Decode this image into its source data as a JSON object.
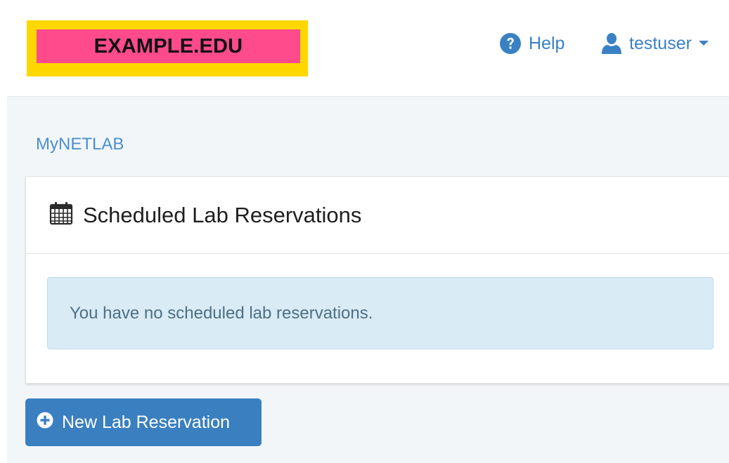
{
  "header": {
    "logo_text": "EXAMPLE.EDU",
    "help_label": "Help",
    "user_label": "testuser"
  },
  "breadcrumb": {
    "label": "MyNETLAB"
  },
  "panel": {
    "title": "Scheduled Lab Reservations",
    "icon": "calendar-icon",
    "empty_message": "You have no scheduled lab reservations."
  },
  "actions": {
    "new_reservation_label": "New Lab Reservation",
    "new_reservation_icon": "plus-circle-icon"
  },
  "colors": {
    "accent": "#3a7fc0",
    "logo_outer": "#ffd700",
    "logo_inner": "#ff4a8c",
    "info_background": "#d9ebf5"
  }
}
